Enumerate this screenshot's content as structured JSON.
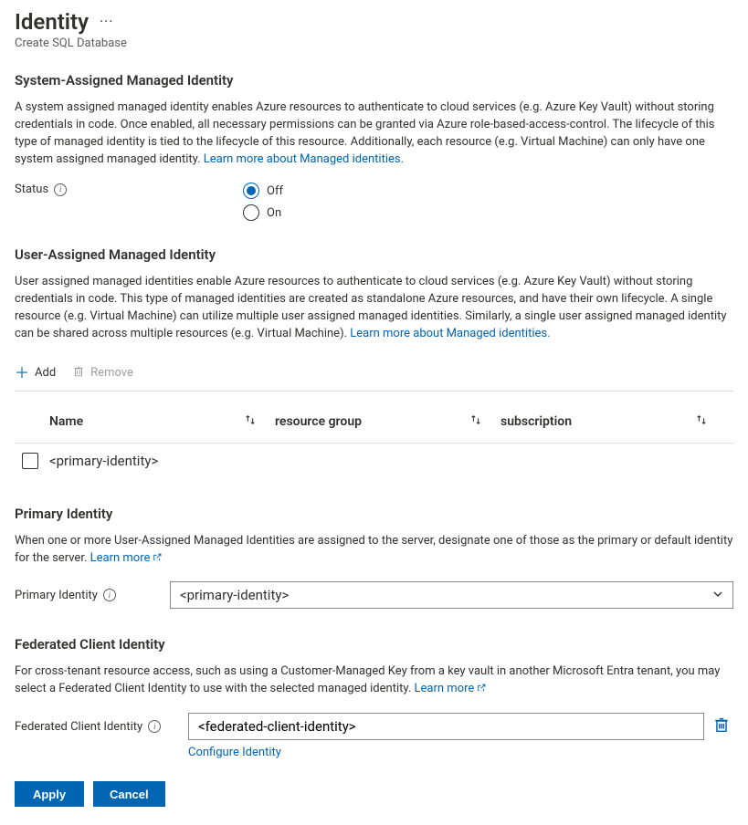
{
  "header": {
    "title": "Identity",
    "subtitle": "Create SQL Database"
  },
  "system_assigned": {
    "heading": "System-Assigned Managed Identity",
    "description": "A system assigned managed identity enables Azure resources to authenticate to cloud services (e.g. Azure Key Vault) without storing credentials in code. Once enabled, all necessary permissions can be granted via Azure role-based-access-control. The lifecycle of this type of managed identity is tied to the lifecycle of this resource. Additionally, each resource (e.g. Virtual Machine) can only have one system assigned managed identity. ",
    "learn_more": "Learn more about Managed identities.",
    "status_label": "Status",
    "options": {
      "off": "Off",
      "on": "On"
    },
    "selected": "off"
  },
  "user_assigned": {
    "heading": "User-Assigned Managed Identity",
    "description": "User assigned managed identities enable Azure resources to authenticate to cloud services (e.g. Azure Key Vault) without storing credentials in code. This type of managed identities are created as standalone Azure resources, and have their own lifecycle. A single resource (e.g. Virtual Machine) can utilize multiple user assigned managed identities. Similarly, a single user assigned managed identity can be shared across multiple resources (e.g. Virtual Machine). ",
    "learn_more": "Learn more about Managed identities.",
    "toolbar": {
      "add": "Add",
      "remove": "Remove"
    },
    "columns": {
      "name": "Name",
      "resource_group": "resource group",
      "subscription": "subscription"
    },
    "rows": [
      {
        "name": "<primary-identity>"
      }
    ]
  },
  "primary_identity": {
    "heading": "Primary Identity",
    "description": "When one or more User-Assigned Managed Identities are assigned to the server, designate one of those as the primary or default identity for the server. ",
    "learn_more": "Learn more",
    "label": "Primary Identity",
    "value": "<primary-identity>"
  },
  "federated": {
    "heading": "Federated Client Identity",
    "description": "For cross-tenant resource access, such as using a Customer-Managed Key from a key vault in another Microsoft Entra tenant, you may select a Federated Client Identity to use with the selected managed identity. ",
    "learn_more": "Learn more",
    "label": "Federated Client Identity",
    "value": "<federated-client-identity>",
    "configure": "Configure Identity"
  },
  "footer": {
    "apply": "Apply",
    "cancel": "Cancel"
  }
}
